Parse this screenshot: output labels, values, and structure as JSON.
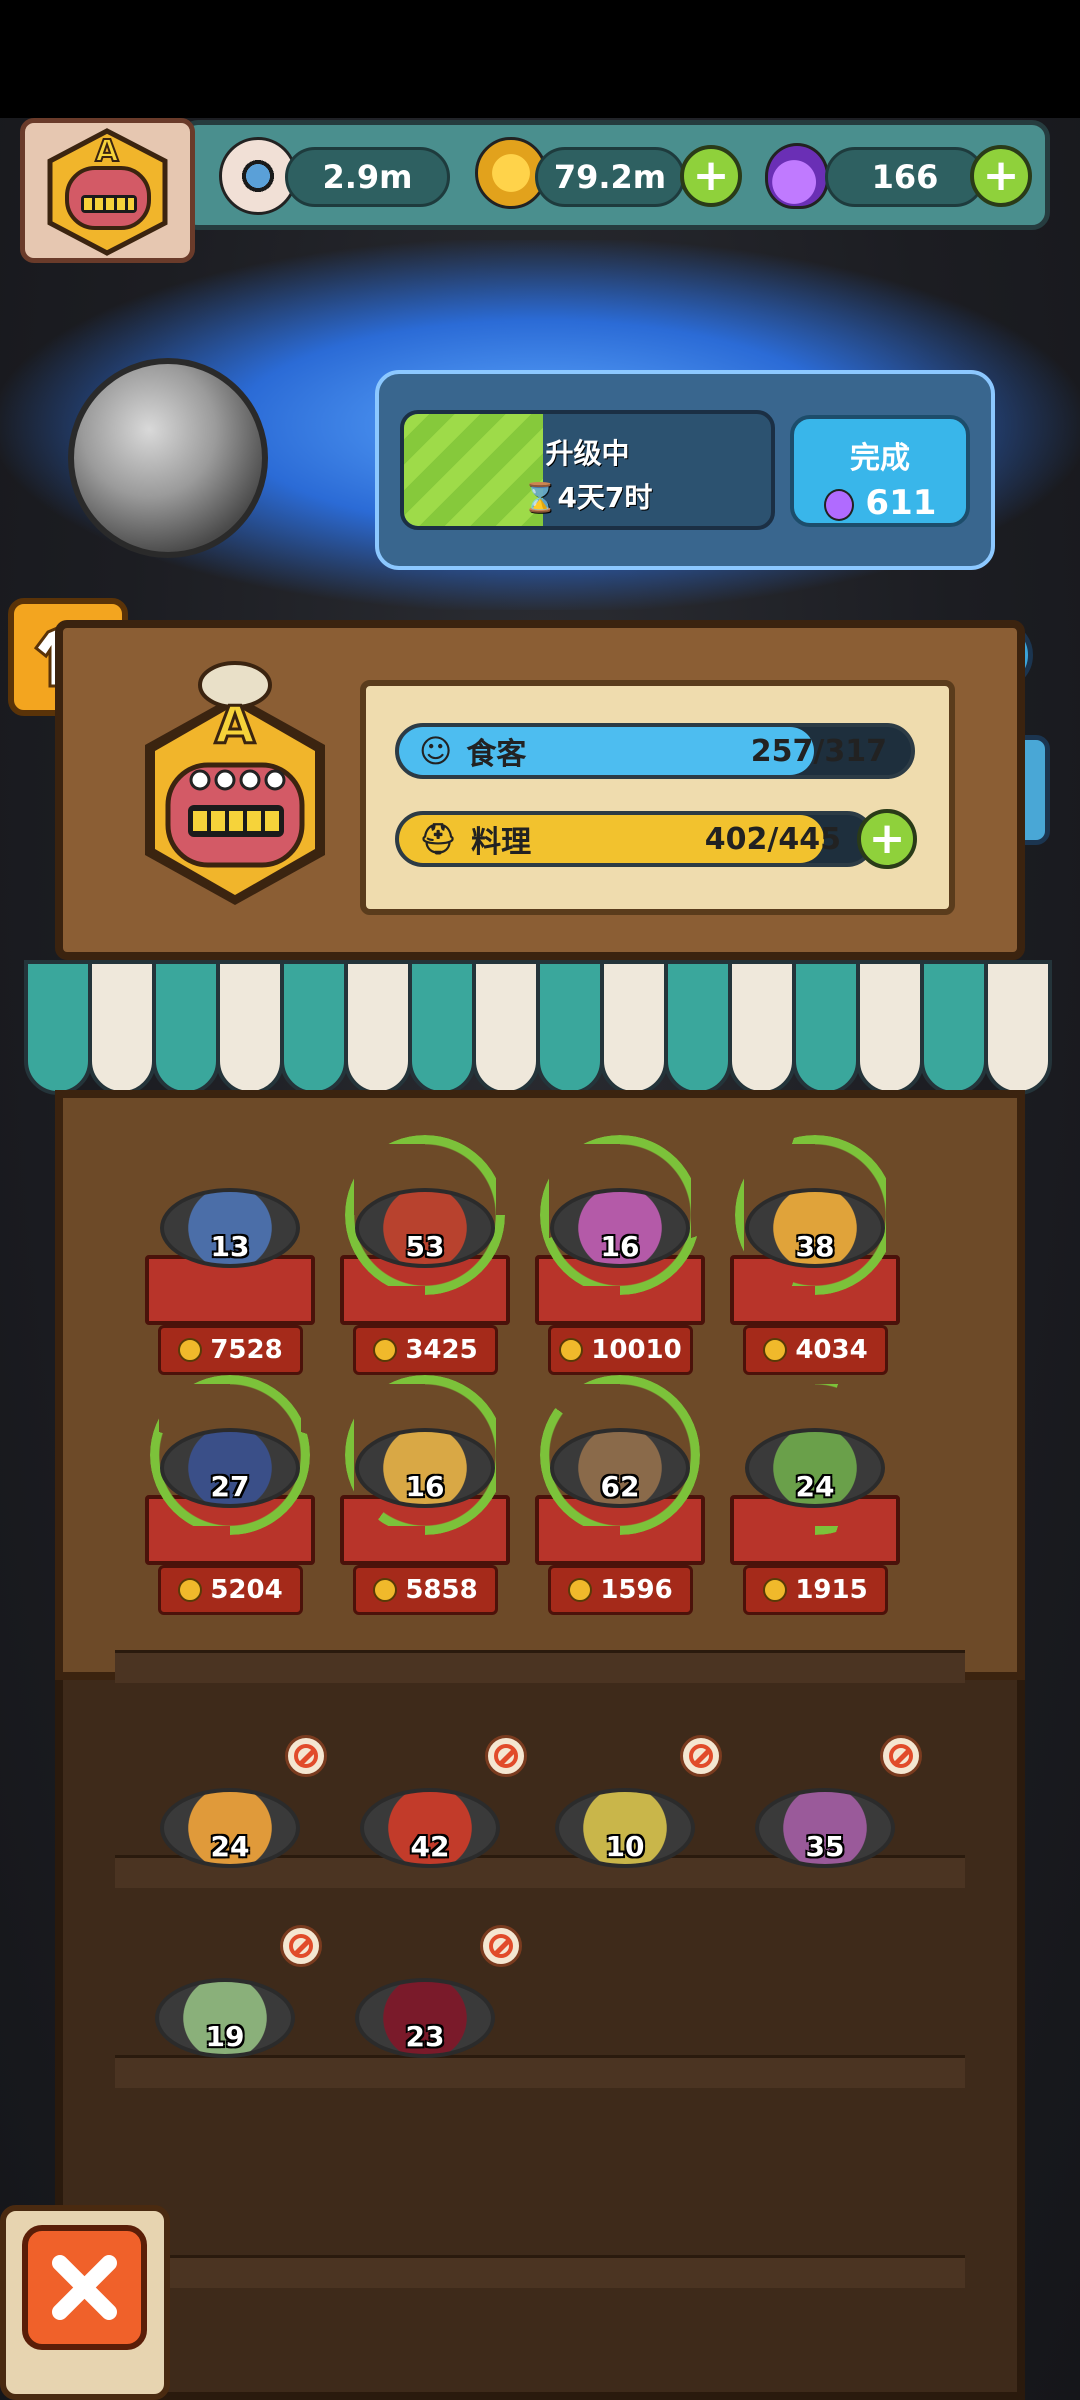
{
  "resources": {
    "eyes": {
      "value": "2.9m",
      "icon": "eyeball-icon"
    },
    "coins": {
      "value": "79.2m",
      "icon": "coin-icon"
    },
    "potions": {
      "value": "166",
      "icon": "potion-icon"
    },
    "plus": "+"
  },
  "upgrade": {
    "status": "升级中",
    "time": "4天7时",
    "progress": 0.38,
    "finish_label": "完成",
    "finish_cost": "611"
  },
  "restaurant": {
    "grade": "A",
    "diners_label": "食客",
    "diners_value": "257/317",
    "diners_fraction": 0.81,
    "dishes_label": "料理",
    "dishes_value": "402/445",
    "dishes_fraction": 0.9,
    "plus": "+"
  },
  "displayed_dishes": [
    {
      "count": "13",
      "price": "7528",
      "ring": 0.0,
      "color": "#4b6ea8"
    },
    {
      "count": "53",
      "price": "3425",
      "ring": 0.75,
      "color": "#b8422e"
    },
    {
      "count": "16",
      "price": "10010",
      "ring": 0.7,
      "color": "#b45aa8"
    },
    {
      "count": "38",
      "price": "4034",
      "ring": 0.55,
      "color": "#e0a33a"
    },
    {
      "count": "27",
      "price": "5204",
      "ring": 0.8,
      "color": "#3a4f88"
    },
    {
      "count": "16",
      "price": "5858",
      "ring": 0.6,
      "color": "#d9a845"
    },
    {
      "count": "62",
      "price": "1596",
      "ring": 0.85,
      "color": "#8a6a4a"
    },
    {
      "count": "24",
      "price": "1915",
      "ring": 0.05,
      "color": "#6aa04a"
    }
  ],
  "stored_dishes": [
    {
      "count": "24",
      "color": "#e09a3a"
    },
    {
      "count": "42",
      "color": "#c23b2a"
    },
    {
      "count": "10",
      "color": "#c9b64a"
    },
    {
      "count": "35",
      "color": "#9a5a9a"
    },
    {
      "count": "19",
      "color": "#8ab07a"
    },
    {
      "count": "23",
      "color": "#7a1a2a"
    }
  ]
}
